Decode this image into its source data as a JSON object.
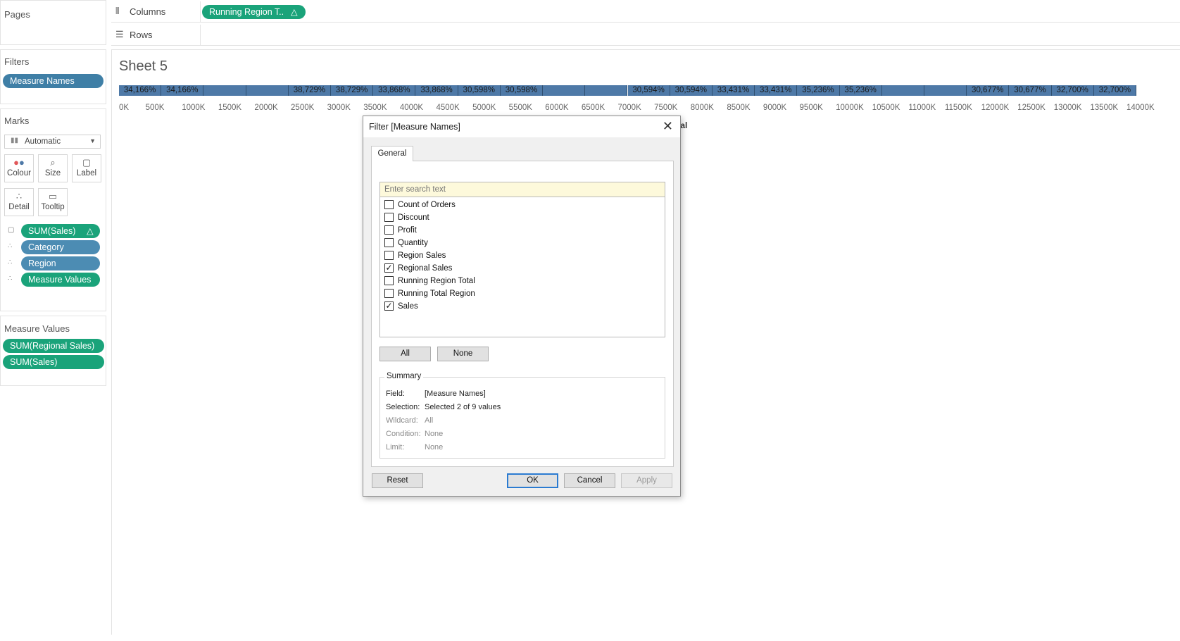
{
  "panels": {
    "pages": "Pages",
    "filters": "Filters",
    "marks": "Marks",
    "measure_values": "Measure Values"
  },
  "filters": {
    "pill": "Measure Names"
  },
  "marks": {
    "type": "Automatic",
    "buttons": {
      "colour": "Colour",
      "size": "Size",
      "label": "Label",
      "detail": "Detail",
      "tooltip": "Tooltip"
    },
    "pills": [
      "SUM(Sales)",
      "Category",
      "Region",
      "Measure Values"
    ]
  },
  "measure_values": [
    "SUM(Regional Sales)",
    "SUM(Sales)"
  ],
  "shelves": {
    "columns": "Columns",
    "rows": "Rows",
    "columns_pill": "Running Region T.."
  },
  "sheet": {
    "title": "Sheet 5",
    "axis_title_fragment": "otal"
  },
  "chart_data": {
    "type": "bar",
    "segment_labels": [
      "34,166%",
      "34,166%",
      "",
      "",
      "38,729%",
      "38,729%",
      "33,868%",
      "33,868%",
      "30,598%",
      "30,598%",
      "",
      "",
      "30,594%",
      "30,594%",
      "33,431%",
      "33,431%",
      "35,236%",
      "35,236%",
      "",
      "",
      "30,677%",
      "30,677%",
      "32,700%",
      "32,700%"
    ],
    "tick_labels": [
      "0K",
      "500K",
      "1000K",
      "1500K",
      "2000K",
      "2500K",
      "3000K",
      "3500K",
      "4000K",
      "4500K",
      "5000K",
      "5500K",
      "6000K",
      "6500K",
      "7000K",
      "7500K",
      "8000K",
      "8500K",
      "9000K",
      "9500K",
      "10000K",
      "10500K",
      "11000K",
      "11500K",
      "12000K",
      "12500K",
      "13000K",
      "13500K",
      "14000K"
    ],
    "xlim": [
      0,
      14000
    ],
    "bar_color": "#4e79a7"
  },
  "dialog": {
    "title": "Filter [Measure Names]",
    "tab": "General",
    "search_placeholder": "Enter search text",
    "items": [
      {
        "label": "Count of Orders",
        "checked": false
      },
      {
        "label": "Discount",
        "checked": false
      },
      {
        "label": "Profit",
        "checked": false
      },
      {
        "label": "Quantity",
        "checked": false
      },
      {
        "label": "Region Sales",
        "checked": false
      },
      {
        "label": "Regional Sales",
        "checked": true
      },
      {
        "label": "Running Region Total",
        "checked": false
      },
      {
        "label": "Running Total Region",
        "checked": false
      },
      {
        "label": "Sales",
        "checked": true
      }
    ],
    "all_label": "All",
    "none_label": "None",
    "summary": {
      "title": "Summary",
      "field_k": "Field:",
      "field_v": "[Measure Names]",
      "selection_k": "Selection:",
      "selection_v": "Selected 2 of 9 values",
      "wildcard_k": "Wildcard:",
      "wildcard_v": "All",
      "condition_k": "Condition:",
      "condition_v": "None",
      "limit_k": "Limit:",
      "limit_v": "None"
    },
    "reset_label": "Reset",
    "ok_label": "OK",
    "cancel_label": "Cancel",
    "apply_label": "Apply"
  }
}
